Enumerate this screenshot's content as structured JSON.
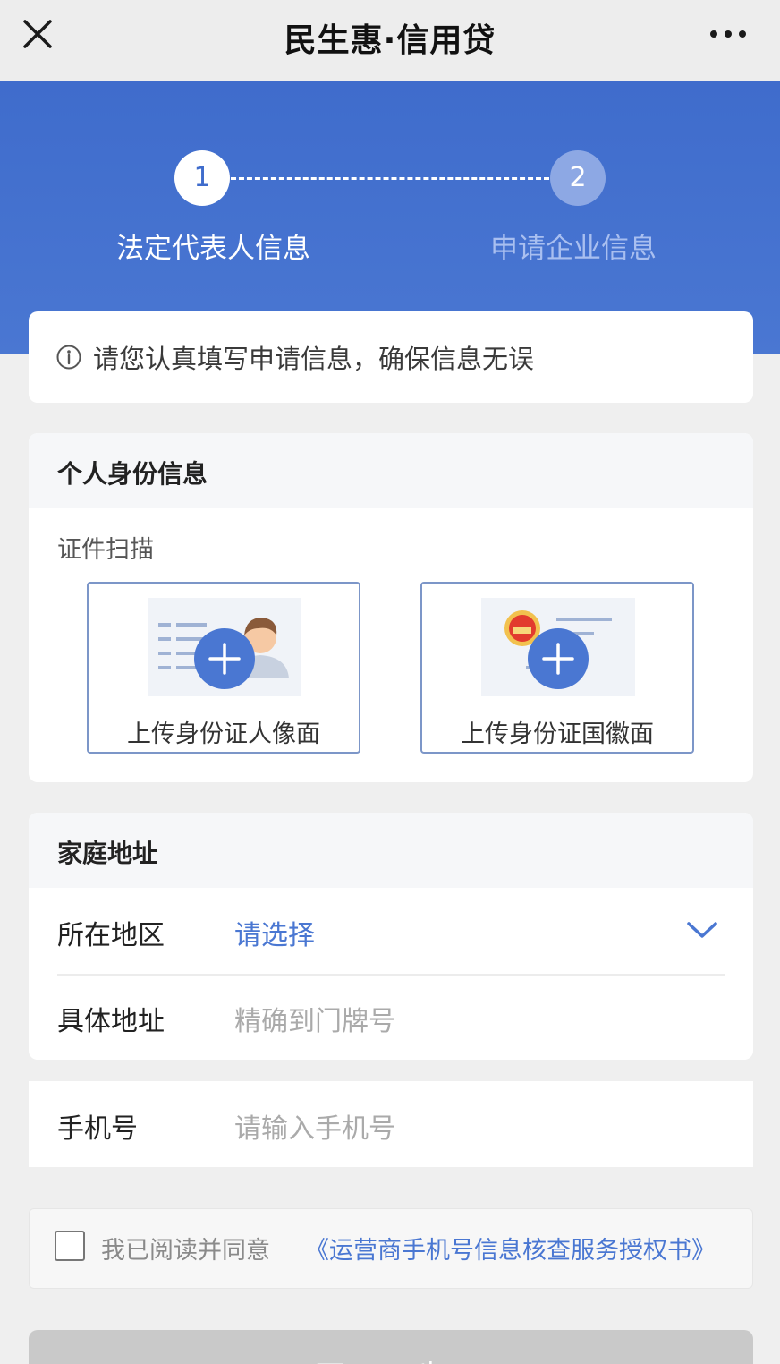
{
  "nav": {
    "title": "民生惠·信用贷"
  },
  "colors": {
    "accent": "#4a77d2",
    "hero": "#3f6ccc",
    "disabled_button": "#c9c9c9"
  },
  "steps": [
    {
      "number": "1",
      "label": "法定代表人信息",
      "state": "active"
    },
    {
      "number": "2",
      "label": "申请企业信息",
      "state": "inactive"
    }
  ],
  "notice": {
    "icon": "info-icon",
    "text": "请您认真填写申请信息，确保信息无误"
  },
  "id_section": {
    "title": "个人身份信息",
    "scan_label": "证件扫描",
    "uploads": [
      {
        "label": "上传身份证人像面",
        "icon": "id-portrait-icon"
      },
      {
        "label": "上传身份证国徽面",
        "icon": "id-emblem-icon"
      }
    ]
  },
  "address_section": {
    "title": "家庭地址",
    "region": {
      "label": "所在地区",
      "value": "请选择"
    },
    "detail": {
      "label": "具体地址",
      "placeholder": "精确到门牌号"
    }
  },
  "phone": {
    "label": "手机号",
    "placeholder": "请输入手机号"
  },
  "agreement": {
    "checked": false,
    "text": "我已阅读并同意",
    "link": "《运营商手机号信息核查服务授权书》"
  },
  "next_button": {
    "label": "下一步"
  }
}
